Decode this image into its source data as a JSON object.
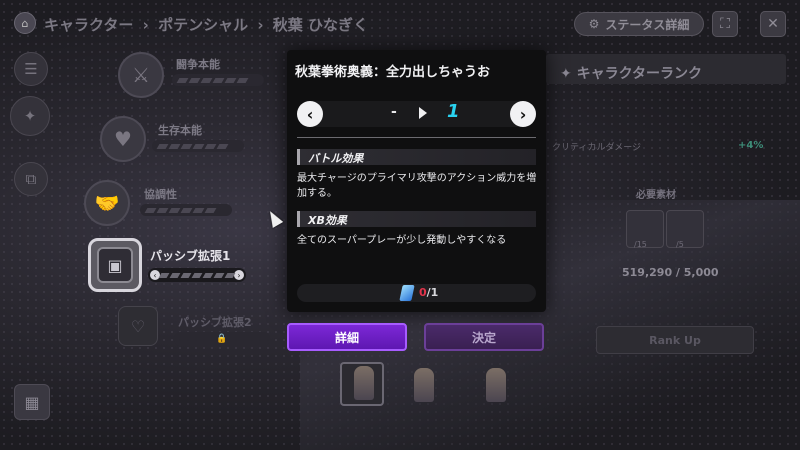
{
  "breadcrumb": {
    "items": [
      "キャラクター",
      "ポテンシャル",
      "秋葉 ひなぎく"
    ],
    "separator": "›"
  },
  "topbar": {
    "status_label": "ステータス詳細",
    "expand_icon": "⛶",
    "close_icon": "✕"
  },
  "stats": [
    {
      "label": "闘争本能"
    },
    {
      "label": "生存本能"
    },
    {
      "label": "協調性"
    }
  ],
  "passive": {
    "label": "パッシブ拡張1",
    "locked_label": "パッシブ拡張2"
  },
  "rank_panel": {
    "title": "キャラクターランク",
    "stat_name": "クリティカルダメージ",
    "stat_pct": "+4%",
    "materials_label": "必要素材",
    "mat1_count": "/15",
    "mat2_count": "/5",
    "money": "519,290 / 5,000",
    "rank_up_label": "Rank Up"
  },
  "modal": {
    "title": "秋葉拳術奥義：全力出しちゃうお",
    "level_from": "-",
    "level_to": "1",
    "prev_icon": "‹",
    "next_icon": "›",
    "battle_header": "バトル効果",
    "battle_text": "最大チャージのプライマリ攻撃のアクション威力を増加する。",
    "xb_header": "XB効果",
    "xb_text": "全てのスーパープレーが少し発動しやすくなる",
    "cost_have": "0",
    "cost_need": "/1"
  },
  "buttons": {
    "detail": "詳細",
    "decide": "決定"
  },
  "colors": {
    "accent_purple": "#7c28d6",
    "level_cyan": "#2ad2f0",
    "cost_red": "#e2344b"
  }
}
